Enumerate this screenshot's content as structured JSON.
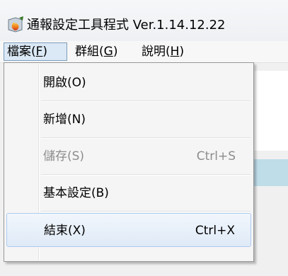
{
  "window": {
    "title": "通報設定工具程式 Ver.1.14.12.22",
    "icon": "app-icon"
  },
  "menubar": {
    "file": {
      "label": "檔案(",
      "accel": "F",
      "close": ")"
    },
    "group": {
      "label": "群組(",
      "accel": "G",
      "close": ")"
    },
    "help": {
      "label": "說明(",
      "accel": "H",
      "close": ")"
    }
  },
  "file_menu": {
    "items": [
      {
        "label": "開啟(O)",
        "shortcut": "",
        "enabled": true
      },
      {
        "label": "新增(N)",
        "shortcut": "",
        "enabled": true
      },
      {
        "label": "儲存(S)",
        "shortcut": "Ctrl+S",
        "enabled": false
      },
      {
        "label": "基本設定(B)",
        "shortcut": "",
        "enabled": true
      },
      {
        "label": "結束(X)",
        "shortcut": "Ctrl+X",
        "enabled": true,
        "highlighted": true
      }
    ]
  },
  "colors": {
    "menu_active_bg": "#dbe8f5",
    "highlight_border": "#aecaf0",
    "disabled_text": "#8d8d8d",
    "panel_blue": "#bfdde9"
  }
}
